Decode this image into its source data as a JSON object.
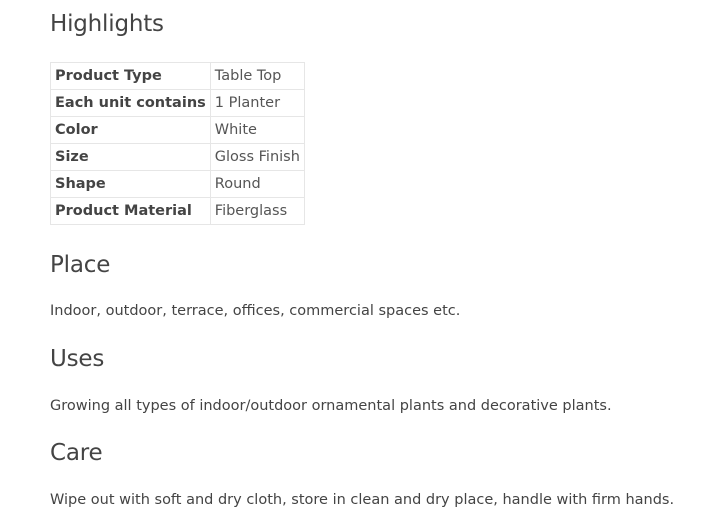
{
  "sections": {
    "highlights": {
      "title": "Highlights",
      "rows": [
        {
          "key": "Product Type",
          "value": "Table Top"
        },
        {
          "key": "Each unit contains",
          "value": "1 Planter"
        },
        {
          "key": "Color",
          "value": "White"
        },
        {
          "key": "Size",
          "value": "Gloss Finish"
        },
        {
          "key": "Shape",
          "value": "Round"
        },
        {
          "key": "Product Material",
          "value": "Fiberglass"
        }
      ]
    },
    "place": {
      "title": "Place",
      "text": "Indoor, outdoor, terrace, offices, commercial spaces etc."
    },
    "uses": {
      "title": "Uses",
      "text": "Growing all types of indoor/outdoor ornamental plants and decorative plants."
    },
    "care": {
      "title": "Care",
      "text": "Wipe out with soft and dry cloth, store in clean and dry place, handle with firm hands."
    }
  }
}
